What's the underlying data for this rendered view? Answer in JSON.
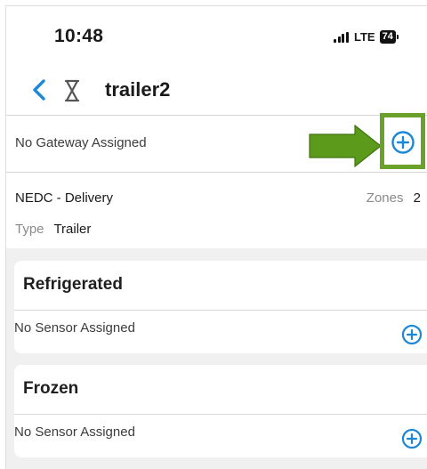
{
  "status_bar": {
    "time": "10:48",
    "network": "LTE",
    "battery": "74"
  },
  "nav": {
    "title": "trailer2",
    "back_icon": "chevron-left-icon",
    "status_icon": "hourglass-icon"
  },
  "gateway": {
    "text": "No Gateway Assigned",
    "add_icon": "plus-circle-icon"
  },
  "annotation": {
    "arrow_color": "#5c9a1b",
    "highlight_color": "#6aa12a"
  },
  "asset": {
    "name": "NEDC - Delivery",
    "zones_label": "Zones",
    "zones_count": "2",
    "type_label": "Type",
    "type_value": "Trailer"
  },
  "zones": [
    {
      "title": "Refrigerated",
      "sensor_text": "No Sensor Assigned"
    },
    {
      "title": "Frozen",
      "sensor_text": "No Sensor Assigned"
    }
  ],
  "colors": {
    "accent": "#1e88d8",
    "background_gray": "#f0f0f0"
  }
}
